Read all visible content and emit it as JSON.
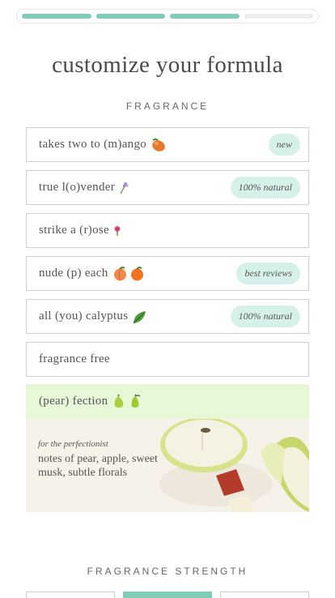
{
  "progress": {
    "total_steps": 4,
    "completed_steps": 3
  },
  "title": "customize your formula",
  "fragrance_label": "FRAGRANCE",
  "options": [
    {
      "label": "takes two to (m)ango",
      "emoji": [
        "mango"
      ],
      "badge": "new"
    },
    {
      "label": "true l(o)vender",
      "emoji": [
        "lavender"
      ],
      "badge": "100% natural"
    },
    {
      "label": "strike a (r)ose",
      "emoji": [
        "rose"
      ],
      "badge": ""
    },
    {
      "label": "nude (p) each",
      "emoji": [
        "peach",
        "peach"
      ],
      "badge": "best reviews"
    },
    {
      "label": "all (you) calyptus",
      "emoji": [
        "leaf"
      ],
      "badge": "100% natural"
    },
    {
      "label": "fragrance free",
      "emoji": [],
      "badge": ""
    },
    {
      "label": "(pear) fection",
      "emoji": [
        "pear",
        "pear"
      ],
      "badge": "",
      "selected": true
    }
  ],
  "selected_detail": {
    "for": "for the perfectionist",
    "notes": "notes of pear, apple, sweet musk, subtle florals"
  },
  "strength_label": "FRAGRANCE STRENGTH",
  "colors": {
    "accent": "#7fcdb8",
    "badge_bg": "#d6f1ea",
    "selected_bg": "#e6f8d8"
  }
}
